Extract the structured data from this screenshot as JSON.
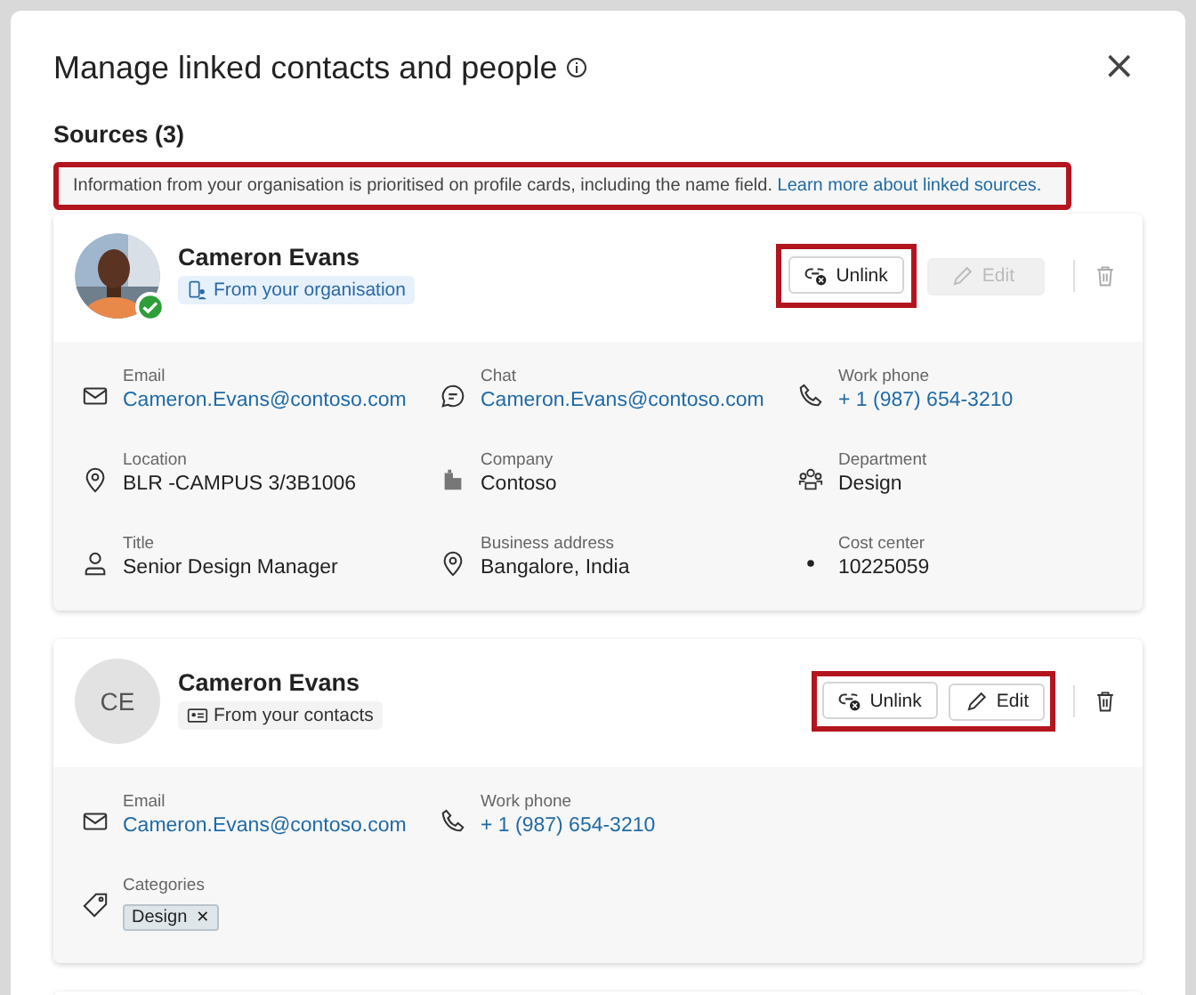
{
  "dialog": {
    "title": "Manage linked contacts and people",
    "close": "×"
  },
  "sources_heading": "Sources (3)",
  "banner": {
    "text": "Information from your organisation is prioritised on profile cards, including the name field.",
    "link": "Learn more about linked sources.",
    "highlighted": true
  },
  "sources": [
    {
      "name": "Cameron Evans",
      "avatar": {
        "kind": "picture",
        "verified": true
      },
      "origin": {
        "kind": "organisation",
        "label": "From your organisation"
      },
      "unlink": "Unlink",
      "edit": {
        "label": "Edit",
        "disabled": true
      },
      "highlight": {
        "unlink": true,
        "edit": false
      },
      "fields": [
        {
          "kind": "email",
          "label": "Email",
          "value": "Cameron.Evans@contoso.com",
          "link": true
        },
        {
          "kind": "chat",
          "label": "Chat",
          "value": "Cameron.Evans@contoso.com",
          "link": true
        },
        {
          "kind": "phone",
          "label": "Work phone",
          "value": "+ 1 (987) 654-3210",
          "link": true
        },
        {
          "kind": "location",
          "label": "Location",
          "value": "BLR -CAMPUS 3/3B1006",
          "link": false
        },
        {
          "kind": "company",
          "label": "Company",
          "value": "Contoso",
          "link": false
        },
        {
          "kind": "department",
          "label": "Department",
          "value": "Design",
          "link": false
        },
        {
          "kind": "person",
          "label": "Title",
          "value": "Senior Design Manager",
          "link": false
        },
        {
          "kind": "location",
          "label": "Business address",
          "value": "Bangalore, India",
          "link": false
        },
        {
          "kind": "dot",
          "label": "Cost  center",
          "value": "10225059",
          "link": false
        }
      ]
    },
    {
      "name": "Cameron Evans",
      "avatar": {
        "kind": "initials",
        "initials": "CE",
        "verified": false
      },
      "origin": {
        "kind": "contacts",
        "label": "From your contacts"
      },
      "unlink": "Unlink",
      "edit": {
        "label": "Edit",
        "disabled": false
      },
      "highlight": {
        "unlink": true,
        "edit": true
      },
      "fields": [
        {
          "kind": "email",
          "label": "Email",
          "value": "Cameron.Evans@contoso.com",
          "link": true
        },
        {
          "kind": "phone",
          "label": "Work phone",
          "value": "+ 1 (987) 654-3210",
          "link": true
        },
        {
          "kind": "tag",
          "label": "Categories",
          "tags": [
            {
              "label": "Design",
              "remove": "✕"
            }
          ]
        }
      ]
    }
  ]
}
